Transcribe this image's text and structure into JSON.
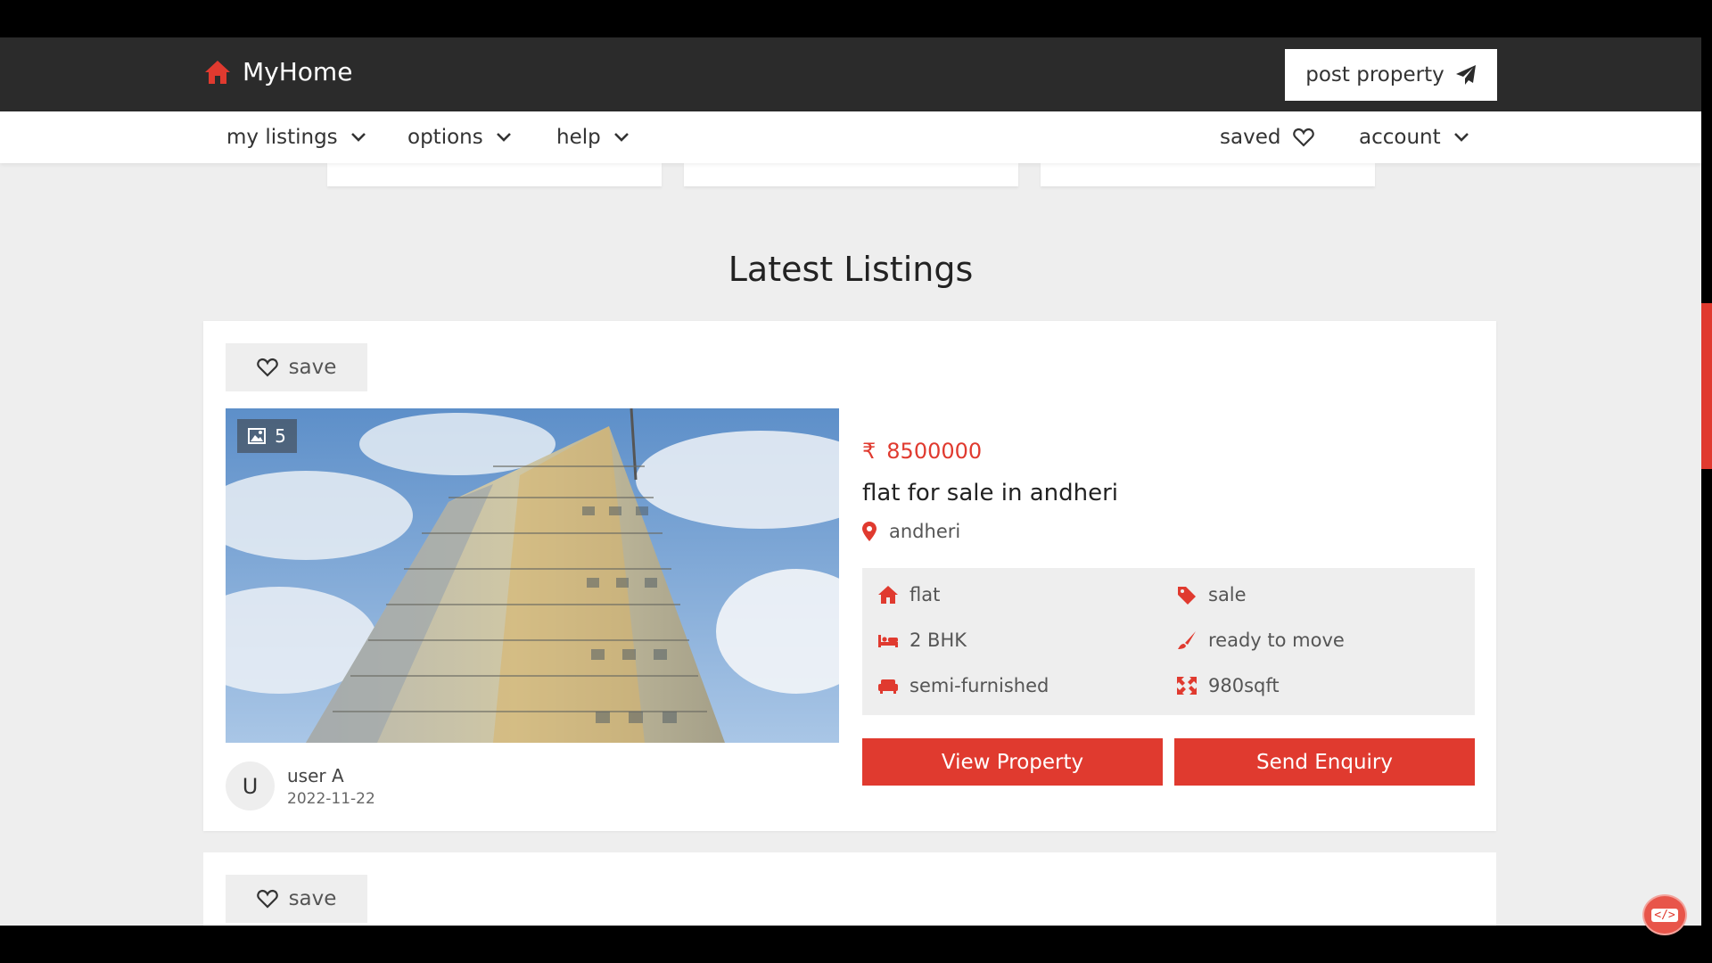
{
  "brand": {
    "name": "MyHome",
    "color": "#e03a2f"
  },
  "header": {
    "post_property_label": "post property"
  },
  "menu": {
    "my_listings": "my listings",
    "options": "options",
    "help": "help",
    "saved": "saved",
    "account": "account"
  },
  "section": {
    "title": "Latest Listings"
  },
  "listings": [
    {
      "save_label": "save",
      "photo_count": "5",
      "price_symbol": "₹",
      "price": "8500000",
      "title": "flat for sale in andheri",
      "location": "andheri",
      "features": {
        "type": "flat",
        "purpose": "sale",
        "bhk": "2 BHK",
        "status": "ready to move",
        "furnishing": "semi-furnished",
        "area": "980sqft"
      },
      "view_label": "View Property",
      "enquiry_label": "Send Enquiry",
      "owner": {
        "initial": "U",
        "name": "user A",
        "date": "2022-11-22"
      }
    },
    {
      "save_label": "save"
    }
  ],
  "chat": {
    "label": "</>"
  },
  "colors": {
    "accent": "#e03a2f",
    "nav_bg": "#2b2b2b",
    "page_bg": "#eeeeee"
  }
}
